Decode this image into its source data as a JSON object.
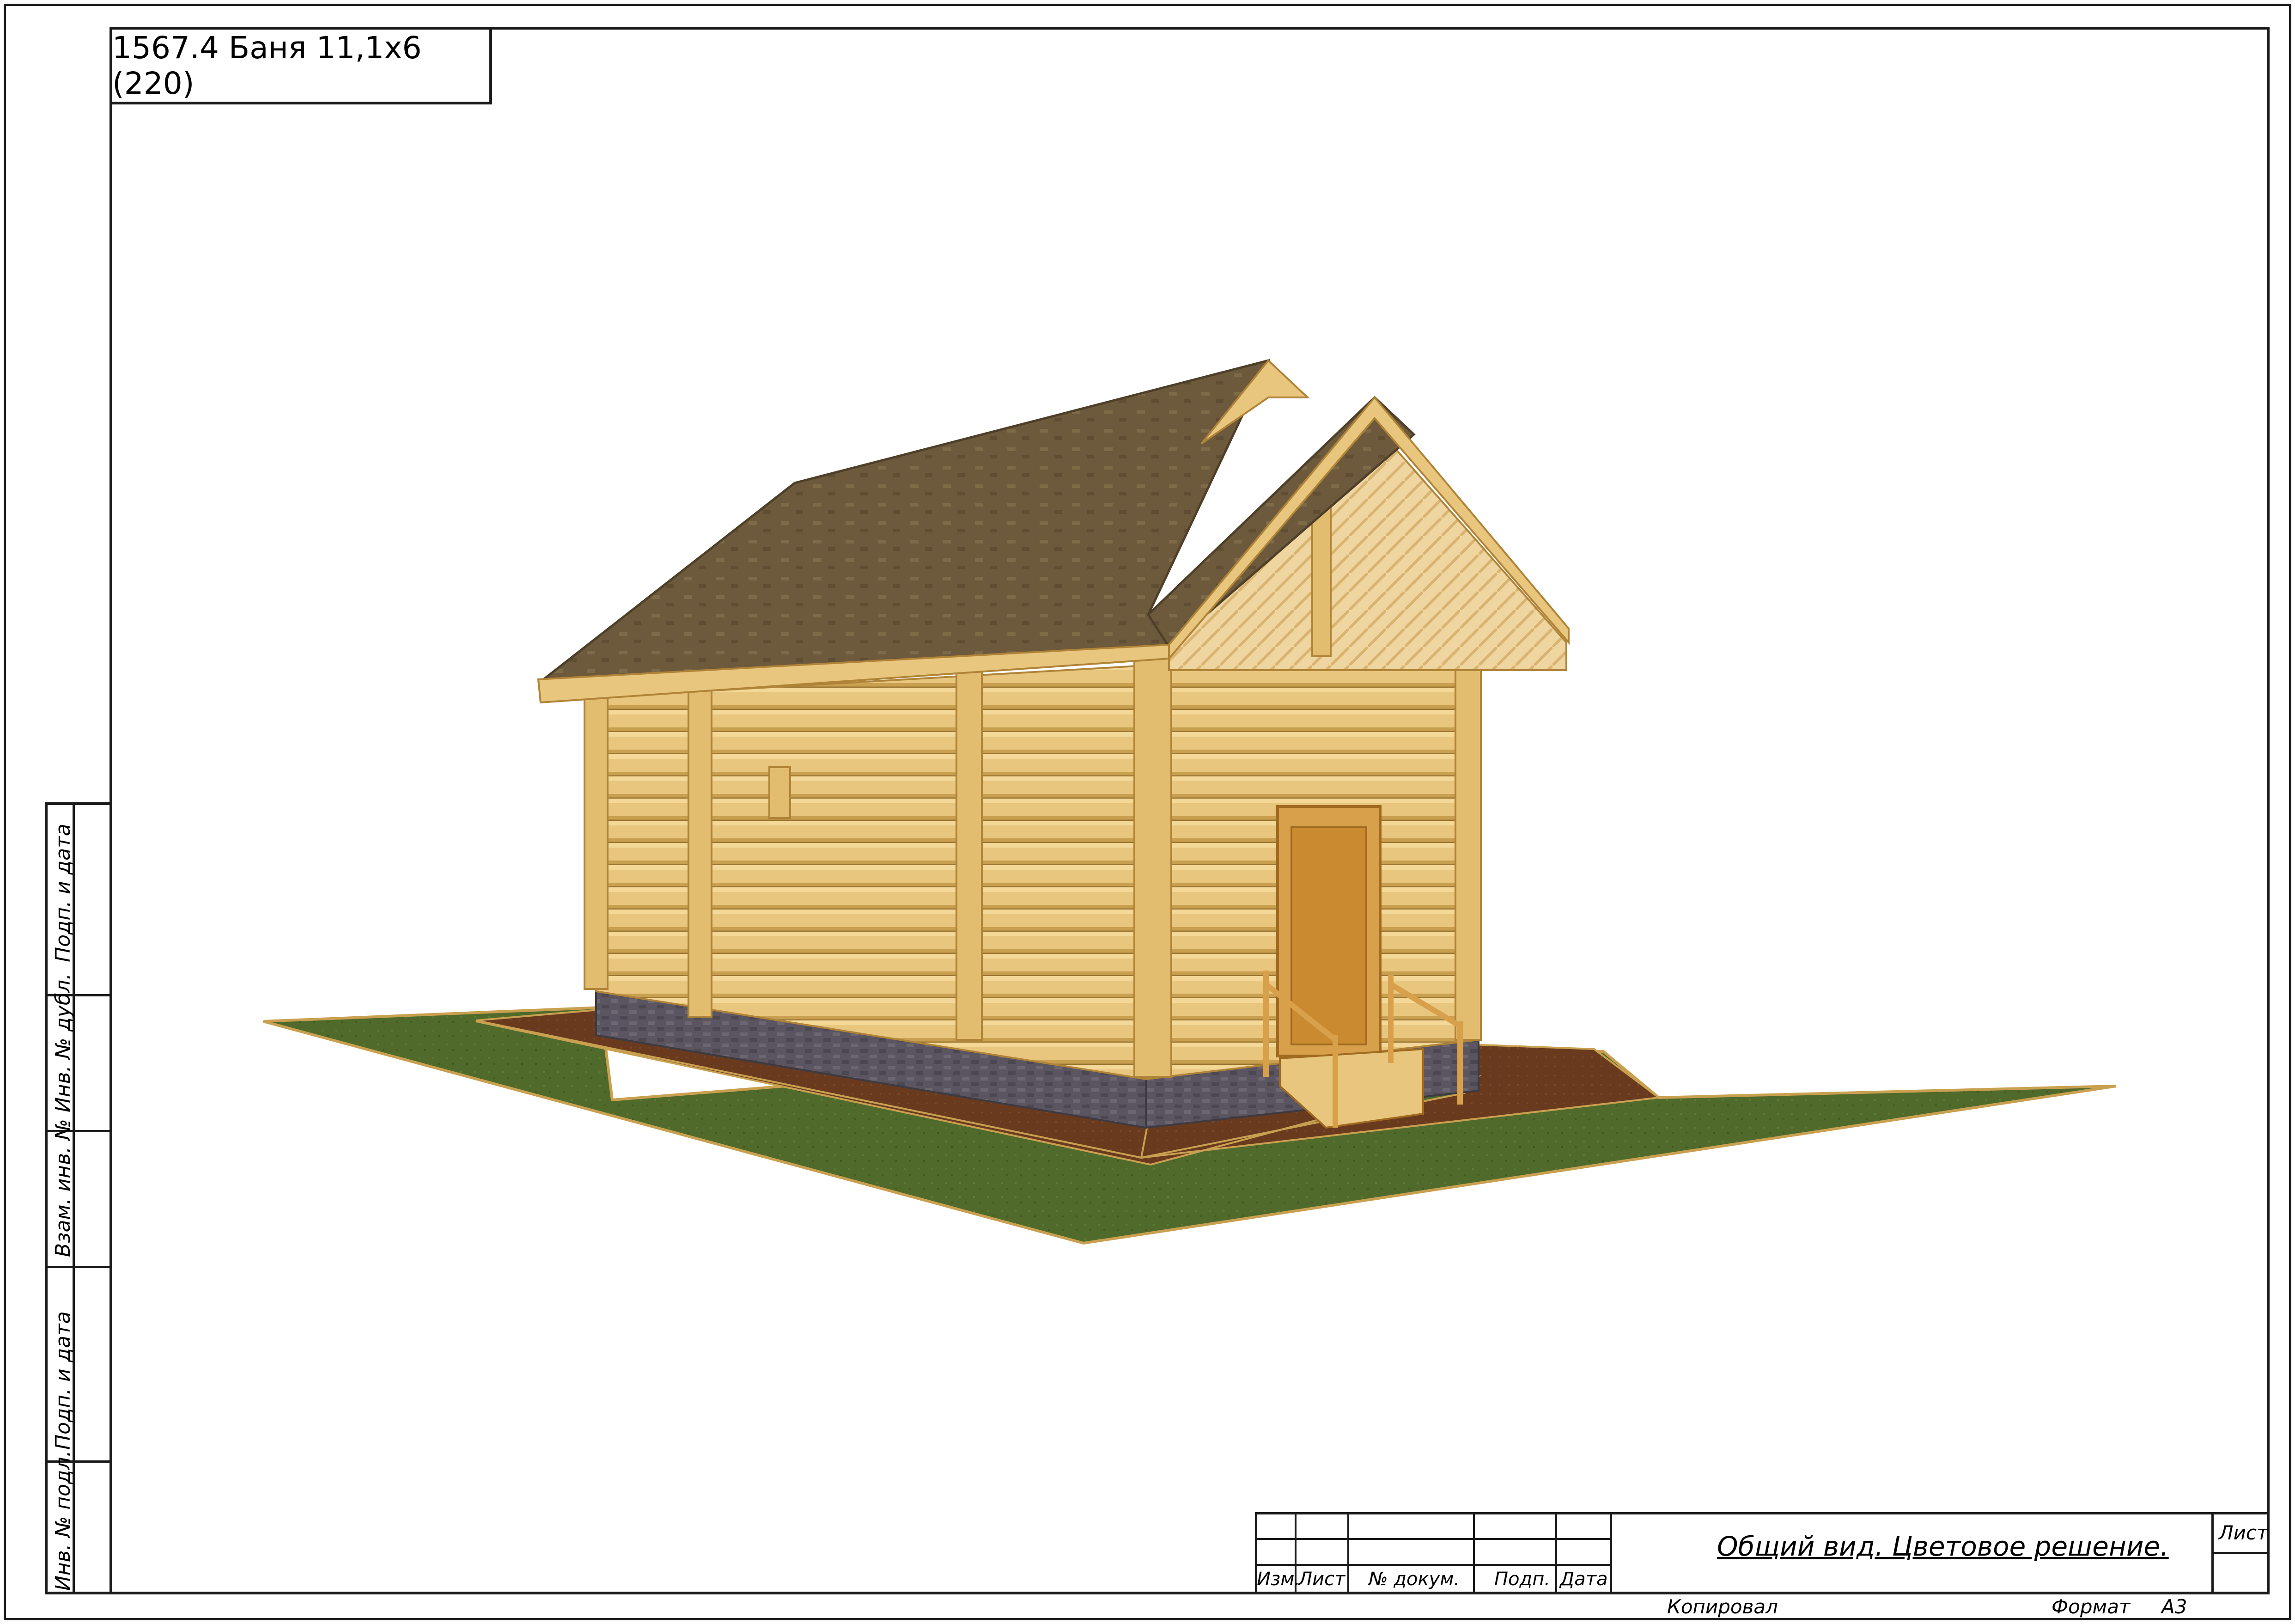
{
  "header": {
    "project_code": "1567.4 Баня 11,1х6 (220)"
  },
  "side_strip": {
    "labels": [
      "Подп. и дата",
      "Инв. № дубл.",
      "Взам. инв. №",
      "Подп. и дата",
      "Инв. № подл."
    ]
  },
  "title_block": {
    "columns": [
      "Изм.",
      "Лист",
      "№ докум.",
      "Подп.",
      "Дата"
    ],
    "sheet_title": "Общий вид. Цветовое решение.",
    "sheet_label": "Лист",
    "copied_label": "Копировал",
    "format_label": "Формат",
    "format_value": "А3"
  },
  "drawing": {
    "description_colors": {
      "log": "#e6c47c",
      "log_shadow": "#c99a45",
      "roof": "#6e5a3a",
      "grass": "#4f6a2a",
      "soil": "#6a3a1e",
      "plinth": "#5d5860",
      "door": "#c98a30"
    }
  }
}
